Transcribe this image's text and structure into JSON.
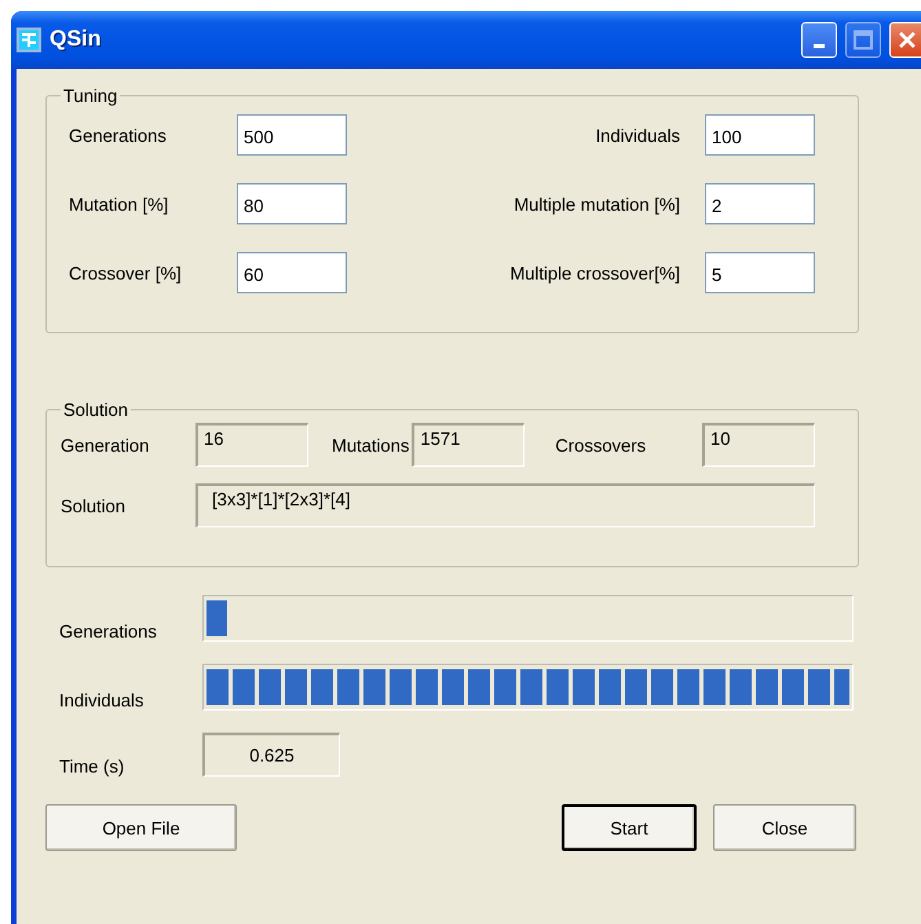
{
  "window": {
    "title": "QSin",
    "maximize_disabled": true
  },
  "tuning": {
    "title": "Tuning",
    "fields": [
      {
        "label": "Generations",
        "value": "500"
      },
      {
        "label": "Individuals",
        "value": "100"
      },
      {
        "label": "Mutation [%]",
        "value": "80"
      },
      {
        "label": "Multiple mutation [%]",
        "value": "2"
      },
      {
        "label": "Crossover [%]",
        "value": "60"
      },
      {
        "label": "Multiple crossover[%]",
        "value": "5"
      }
    ]
  },
  "solution": {
    "title": "Solution",
    "stats": [
      {
        "label": "Generation",
        "value": "16"
      },
      {
        "label": "Mutations",
        "value": "1571"
      },
      {
        "label": "Crossovers",
        "value": "10"
      }
    ],
    "result": {
      "label": "Solution",
      "value": "[3x3]*[1]*[2x3]*[4]"
    }
  },
  "progress": [
    {
      "label": "Generations",
      "level": 0.032
    },
    {
      "label": "Individuals",
      "level": 1.0
    }
  ],
  "time": {
    "label": "Time (s)",
    "value": "0.625"
  },
  "buttons": [
    {
      "label": "Open File",
      "default": false
    },
    {
      "label": "Start",
      "default": true
    },
    {
      "label": "Close",
      "default": false
    }
  ]
}
